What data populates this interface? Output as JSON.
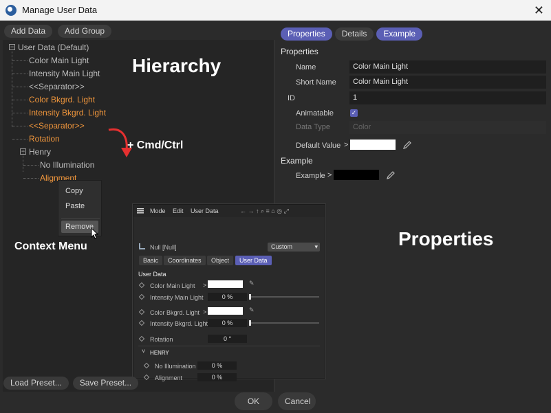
{
  "window": {
    "title": "Manage User Data",
    "close_glyph": "✕"
  },
  "left": {
    "add_data": "Add Data",
    "add_group": "Add Group",
    "tree": {
      "root_label": "User Data (Default)",
      "items": [
        {
          "label": "Color Main Light"
        },
        {
          "label": "Intensity Main Light"
        },
        {
          "label": "<<Separator>>"
        },
        {
          "label": "Color Bkgrd. Light"
        },
        {
          "label": "Intensity Bkgrd. Light"
        },
        {
          "label": "<<Separator>>"
        },
        {
          "label": "Rotation"
        },
        {
          "label": "Henry"
        },
        {
          "label": "No Illumination"
        },
        {
          "label": "Alignment"
        }
      ]
    },
    "load_preset": "Load Preset...",
    "save_preset": "Save Preset..."
  },
  "overlays": {
    "hierarchy": "Hierarchy",
    "shortcut": "+ Cmd/Ctrl",
    "context_menu": "Context Menu",
    "properties": "Properties"
  },
  "context_menu": {
    "copy": "Copy",
    "paste": "Paste",
    "remove": "Remove"
  },
  "right": {
    "tabs": [
      "Properties",
      "Details",
      "Example"
    ],
    "properties_title": "Properties",
    "name_label": "Name",
    "name_value": "Color Main Light",
    "short_name_label": "Short Name",
    "short_name_value": "Color Main Light",
    "id_label": "ID",
    "id_value": "1",
    "animatable_label": "Animatable",
    "checkmark": "✓",
    "chevron": ">",
    "data_type_label": "Data Type",
    "data_type_value": "Color",
    "default_value_label": "Default Value",
    "example_title": "Example",
    "example_label": "Example"
  },
  "attribute_manager": {
    "menu": {
      "mode": "Mode",
      "edit": "Edit",
      "user_data": "User Data"
    },
    "object_name": "Null [Null]",
    "dropdown": "Custom",
    "tabs": [
      "Basic",
      "Coordinates",
      "Object",
      "User Data"
    ],
    "section": "User Data",
    "rows": {
      "color_main": "Color Main Light",
      "intensity_main": "Intensity Main Light",
      "intensity_main_value": "0 %",
      "color_bkgrd": "Color Bkgrd. Light",
      "intensity_bkgrd": "Intensity Bkgrd. Light",
      "intensity_bkgrd_value": "0 %",
      "rotation": "Rotation",
      "rotation_value": "0 °"
    },
    "group": {
      "label": "HENRY",
      "no_illum": "No Illumination",
      "no_illum_value": "0 %",
      "alignment": "Alignment",
      "alignment_value": "0 %"
    }
  },
  "buttons": {
    "ok": "OK",
    "cancel": "Cancel"
  },
  "colors": {
    "accent": "#5b5fb5",
    "orange": "#f0963c",
    "arrow": "#e53030"
  }
}
